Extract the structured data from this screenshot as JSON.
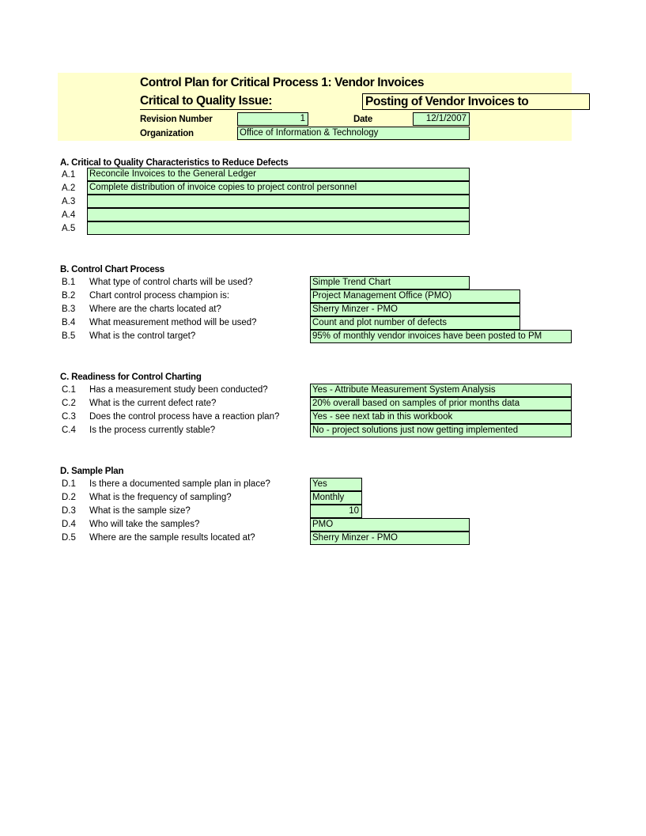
{
  "document": {
    "header": {
      "title": "Control Plan for Critical Process 1: Vendor Invoices",
      "ctq_label": "Critical to Quality Issue:",
      "ctq_value": "Posting of Vendor Invoices to",
      "revision_label": "Revision Number",
      "revision_value": "1",
      "date_label": "Date",
      "date_value": "12/1/2007",
      "organization_label": "Organization",
      "organization_value": "Office of Information & Technology",
      "background_color": "#FFFFCC",
      "cell_color": "#CCFFCC"
    },
    "sections": [
      {
        "title": "A. Critical to Quality Characteristics to Reduce Defects",
        "rows": [
          {
            "id": "A.1",
            "question": "",
            "value": "Reconcile Invoices to the General Ledger"
          },
          {
            "id": "A.2",
            "question": "",
            "value": "Complete distribution of invoice copies to project control personnel"
          },
          {
            "id": "A.3",
            "question": "",
            "value": ""
          },
          {
            "id": "A.4",
            "question": "",
            "value": ""
          },
          {
            "id": "A.5",
            "question": "",
            "value": ""
          }
        ]
      },
      {
        "title": "B. Control Chart Process",
        "rows": [
          {
            "id": "B.1",
            "question": "What type of control charts will be used?",
            "value": "Simple Trend Chart"
          },
          {
            "id": "B.2",
            "question": "Chart control process champion is:",
            "value": "Project Management Office (PMO)"
          },
          {
            "id": "B.3",
            "question": "Where are the charts located at?",
            "value": "Sherry Minzer - PMO"
          },
          {
            "id": "B.4",
            "question": "What measurement method will be used?",
            "value": "Count and plot number of defects"
          },
          {
            "id": "B.5",
            "question": "What is the control target?",
            "value": "95% of monthly vendor invoices have been posted to PM"
          }
        ]
      },
      {
        "title": "C. Readiness for Control Charting",
        "rows": [
          {
            "id": "C.1",
            "question": "Has a measurement study been conducted?",
            "value": "Yes - Attribute Measurement System Analysis"
          },
          {
            "id": "C.2",
            "question": "What is the current defect rate?",
            "value": "20% overall based on samples of prior months data"
          },
          {
            "id": "C.3",
            "question": "Does the control process have a reaction plan?",
            "value": "Yes - see next tab in this workbook"
          },
          {
            "id": "C.4",
            "question": "Is the process currently stable?",
            "value": "No - project solutions just now getting implemented"
          }
        ]
      },
      {
        "title": "D. Sample Plan",
        "rows": [
          {
            "id": "D.1",
            "question": "Is there a documented sample plan in place?",
            "value": "Yes"
          },
          {
            "id": "D.2",
            "question": "What is the frequency of sampling?",
            "value": "Monthly"
          },
          {
            "id": "D.3",
            "question": "What is the sample size?",
            "value": "10"
          },
          {
            "id": "D.4",
            "question": "Who will take the samples?",
            "value": "PMO"
          },
          {
            "id": "D.5",
            "question": "Where are the sample results located at?",
            "value": "Sherry Minzer - PMO"
          }
        ]
      }
    ]
  }
}
